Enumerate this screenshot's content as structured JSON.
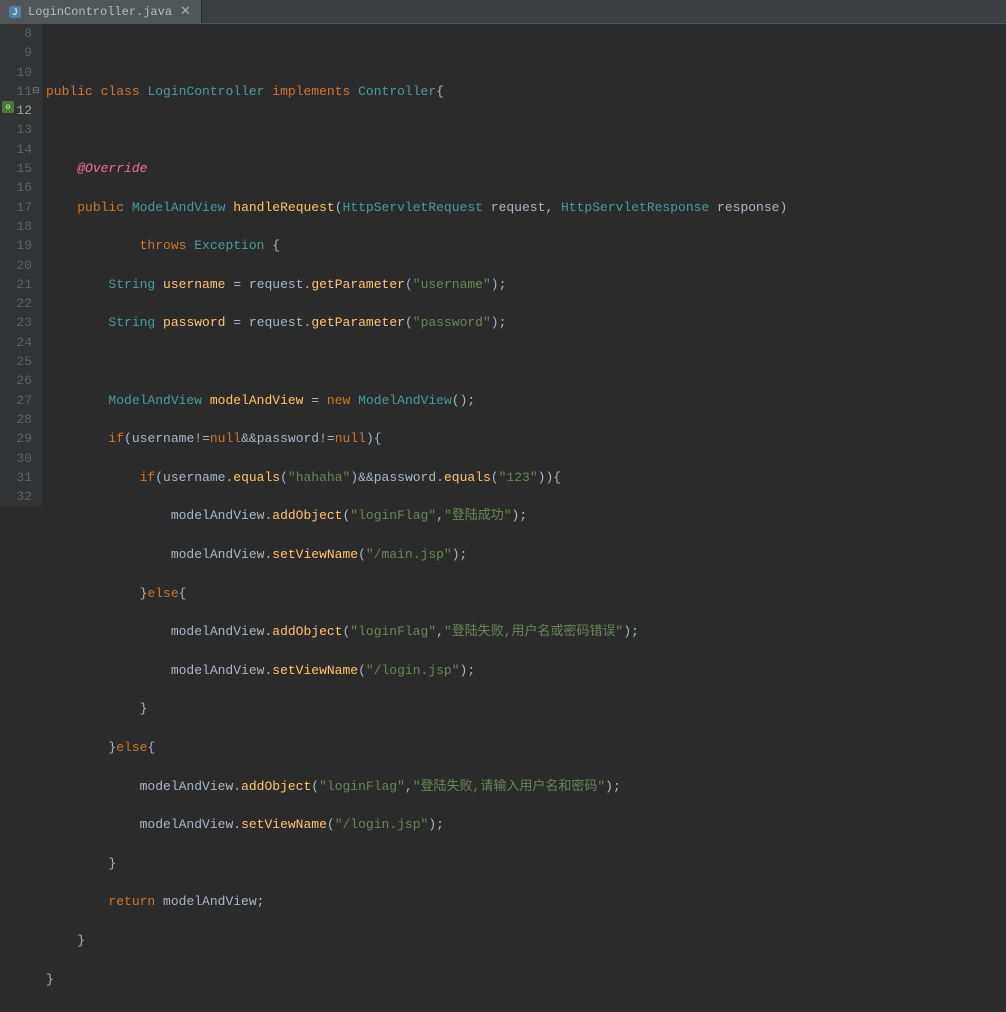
{
  "tab": {
    "filename": "LoginController.java",
    "close": "✕"
  },
  "lines": {
    "l8": "8",
    "l9": "9",
    "l10": "10",
    "l11": "11",
    "l12": "12",
    "l13": "13",
    "l14": "14",
    "l15": "15",
    "l16": "16",
    "l17": "17",
    "l18": "18",
    "l19": "19",
    "l20": "20",
    "l21": "21",
    "l22": "22",
    "l23": "23",
    "l24": "24",
    "l25": "25",
    "l26": "26",
    "l27": "27",
    "l28": "28",
    "l29": "29",
    "l30": "30",
    "l31": "31",
    "l32": "32"
  },
  "code": {
    "kw_public": "public",
    "kw_class": "class",
    "kw_implements": "implements",
    "kw_throws": "throws",
    "kw_new": "new",
    "kw_if": "if",
    "kw_else": "else",
    "kw_null": "null",
    "kw_return": "return",
    "cls_LoginController": "LoginController",
    "cls_Controller": "Controller",
    "cls_ModelAndView": "ModelAndView",
    "cls_HttpServletRequest": "HttpServletRequest",
    "cls_HttpServletResponse": "HttpServletResponse",
    "cls_Exception": "Exception",
    "cls_String": "String",
    "ann_Override": "@Override",
    "mth_handleRequest": "handleRequest",
    "mth_getParameter": "getParameter",
    "mth_addObject": "addObject",
    "mth_setViewName": "setViewName",
    "mth_equals": "equals",
    "var_request": "request",
    "var_response": "response",
    "var_username": "username",
    "var_password": "password",
    "var_modelAndView": "modelAndView",
    "str_username": "\"username\"",
    "str_password": "\"password\"",
    "str_hahaha": "\"hahaha\"",
    "str_123": "\"123\"",
    "str_loginFlag": "\"loginFlag\"",
    "str_success": "\"登陆成功\"",
    "str_main": "\"/main.jsp\"",
    "str_fail1": "\"登陆失败,用户名或密码错误\"",
    "str_login": "\"/login.jsp\"",
    "str_fail2": "\"登陆失败,请输入用户名和密码\"",
    "p_obrace": "{",
    "p_cbrace": "}",
    "p_oparen": "(",
    "p_cparen": ")",
    "p_comma": ",",
    "p_semi": ";",
    "p_eq": "=",
    "p_neq": "!=",
    "p_and": "&&",
    "p_dot": "."
  }
}
